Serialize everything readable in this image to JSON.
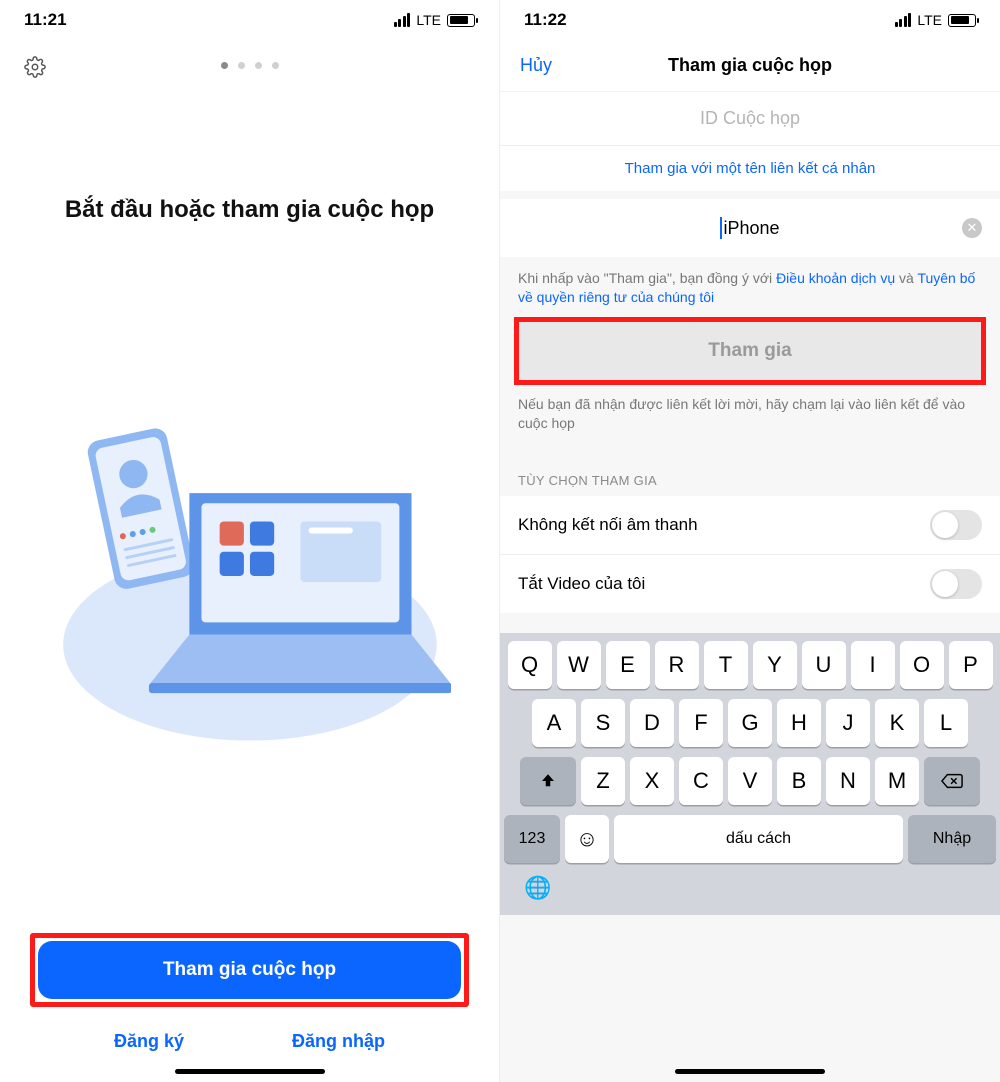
{
  "left": {
    "status": {
      "time": "11:21",
      "network": "LTE"
    },
    "title": "Bắt đầu hoặc tham gia cuộc họp",
    "join_button": "Tham gia cuộc họp",
    "signup": "Đăng ký",
    "signin": "Đăng nhập"
  },
  "right": {
    "status": {
      "time": "11:22",
      "network": "LTE"
    },
    "cancel": "Hủy",
    "nav_title": "Tham gia cuộc họp",
    "meeting_id_placeholder": "ID Cuộc họp",
    "personal_link": "Tham gia với một tên liên kết cá nhân",
    "name_value": "iPhone",
    "disclaimer": {
      "pre": "Khi nhấp vào \"Tham gia\", bạn đồng ý với ",
      "tos": "Điều khoản dịch vụ",
      "mid": " và ",
      "privacy": "Tuyên bố về quyền riêng tư của chúng tôi"
    },
    "join_label": "Tham gia",
    "help_text": "Nếu bạn đã nhận được liên kết lời mời, hãy chạm lại vào liên kết để vào cuộc họp",
    "options_header": "TÙY CHỌN THAM GIA",
    "opt_audio": "Không kết nối âm thanh",
    "opt_video": "Tắt Video của tôi",
    "keyboard": {
      "row1": [
        "Q",
        "W",
        "E",
        "R",
        "T",
        "Y",
        "U",
        "I",
        "O",
        "P"
      ],
      "row2": [
        "A",
        "S",
        "D",
        "F",
        "G",
        "H",
        "J",
        "K",
        "L"
      ],
      "row3": [
        "Z",
        "X",
        "C",
        "V",
        "B",
        "N",
        "M"
      ],
      "numeric": "123",
      "space": "dấu cách",
      "enter": "Nhập"
    }
  }
}
